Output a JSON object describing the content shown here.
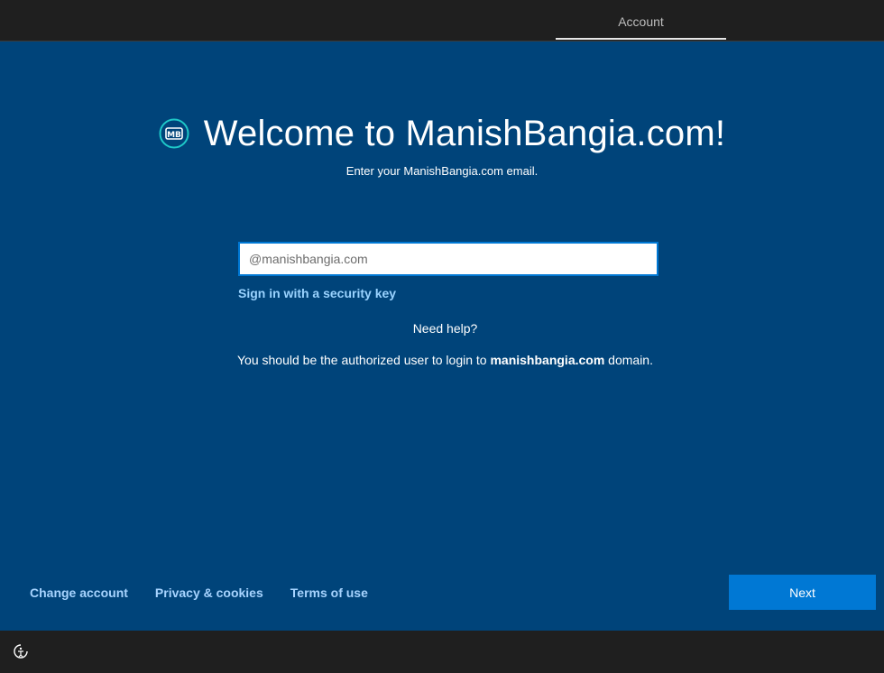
{
  "top_bar": {
    "tab_label": "Account"
  },
  "header": {
    "logo_text": "MB",
    "title": "Welcome to ManishBangia.com!",
    "subtitle": "Enter your ManishBangia.com email."
  },
  "form": {
    "email_placeholder": "@manishbangia.com",
    "email_value": "",
    "security_key_link": "Sign in with a security key",
    "need_help": "Need help?",
    "notice_prefix": "You should be the authorized user to login to ",
    "notice_domain": "manishbangia.com",
    "notice_suffix": " domain."
  },
  "footer": {
    "links": [
      "Change account",
      "Privacy & cookies",
      "Terms of use"
    ],
    "next_label": "Next"
  },
  "bottom_bar": {
    "icon": "ease-of-access-icon"
  },
  "colors": {
    "background": "#00447a",
    "accent": "#0078d4",
    "link": "#9ad3ff",
    "bar": "#1f1f1f"
  }
}
